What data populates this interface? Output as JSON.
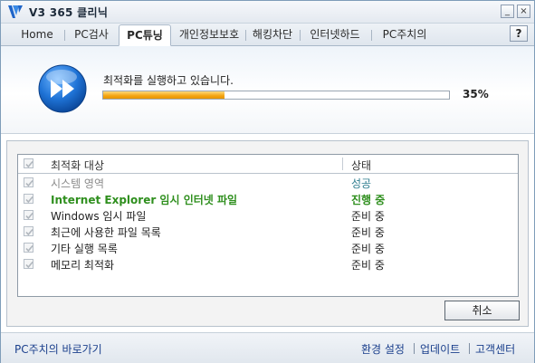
{
  "window": {
    "title": "V3 365 클리닉",
    "min_label": "_",
    "close_label": "×"
  },
  "tabs": [
    {
      "label": "Home"
    },
    {
      "label": "PC검사"
    },
    {
      "label": "PC튜닝"
    },
    {
      "label": "개인정보보호"
    },
    {
      "label": "해킹차단"
    },
    {
      "label": "인터넷하드"
    },
    {
      "label": "PC주치의"
    }
  ],
  "active_tab": "PC튜닝",
  "help_label": "?",
  "progress": {
    "status_text": "최적화를 실행하고 있습니다.",
    "percent_label": "35%",
    "fraction": 0.35
  },
  "list": {
    "headers": {
      "target": "최적화 대상",
      "status": "상태"
    },
    "rows": [
      {
        "target": "시스템 영역",
        "status": "성공",
        "state": "done"
      },
      {
        "target": "Internet Explorer 임시 인터넷 파일",
        "status": "진행 중",
        "state": "active"
      },
      {
        "target": "Windows 임시 파일",
        "status": "준비 중",
        "state": "wait"
      },
      {
        "target": "최근에 사용한 파일 목록",
        "status": "준비 중",
        "state": "wait"
      },
      {
        "target": "기타 실행 목록",
        "status": "준비 중",
        "state": "wait"
      },
      {
        "target": "메모리 최적화",
        "status": "준비 중",
        "state": "wait"
      }
    ]
  },
  "cancel_label": "취소",
  "footer": {
    "shortcut_link": "PC주치의 바로가기",
    "settings_link": "환경 설정",
    "update_link": "업데이트",
    "support_link": "고객센터"
  },
  "colors": {
    "accent_blue": "#1f73d6",
    "progress_orange": "#f3a512",
    "active_green": "#2f8f1e",
    "link_blue": "#1a3f8c"
  },
  "icons": {
    "app": "v3-logo-icon",
    "optimize": "fast-forward-icon",
    "checkbox": "checkbox-checked-icon"
  }
}
